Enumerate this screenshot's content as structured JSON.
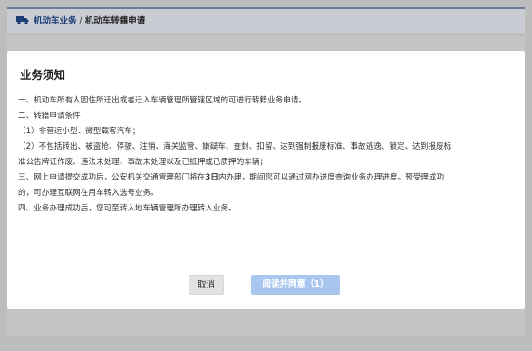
{
  "breadcrumb": {
    "icon": "truck-icon",
    "link_label": "机动车业务",
    "separator": "/",
    "current_label": "机动车转籍申请"
  },
  "modal": {
    "title": "业务须知",
    "lines": [
      "一、机动车所有人因住所迁出或者迁入车辆管理所管辖区域的可进行转籍业务申请。",
      "二、转籍申请条件",
      "（1）非营运小型、微型载客汽车；",
      "（2）不包括转出、被盗抢、停驶、注销、海关监管、嫌疑车、查封、扣留、达到强制报废标准、事故逃逸、锁定、达到报废标",
      "准公告牌证作废、违法未处理、事故未处理以及已抵押或已质押的车辆；",
      {
        "before": "三、网上申请提交成功后，公安机关交通管理部门将在",
        "bold": "3日",
        "after": "内办理，期间您可以通过网办进度查询业务办理进度。预受理成功"
      },
      "的，可办理互联网在用车转入选号业务。",
      "四、业务办理成功后，您可至转入地车辆管理所办理转入业务。"
    ],
    "cancel_label": "取消",
    "agree_label": "阅读并同意（1）"
  },
  "colors": {
    "agree_button": "#a9c7ee",
    "cancel_button": "#e3e3e3",
    "breadcrumb_link": "#1d3d78",
    "overlay": "#bdbdbd"
  }
}
